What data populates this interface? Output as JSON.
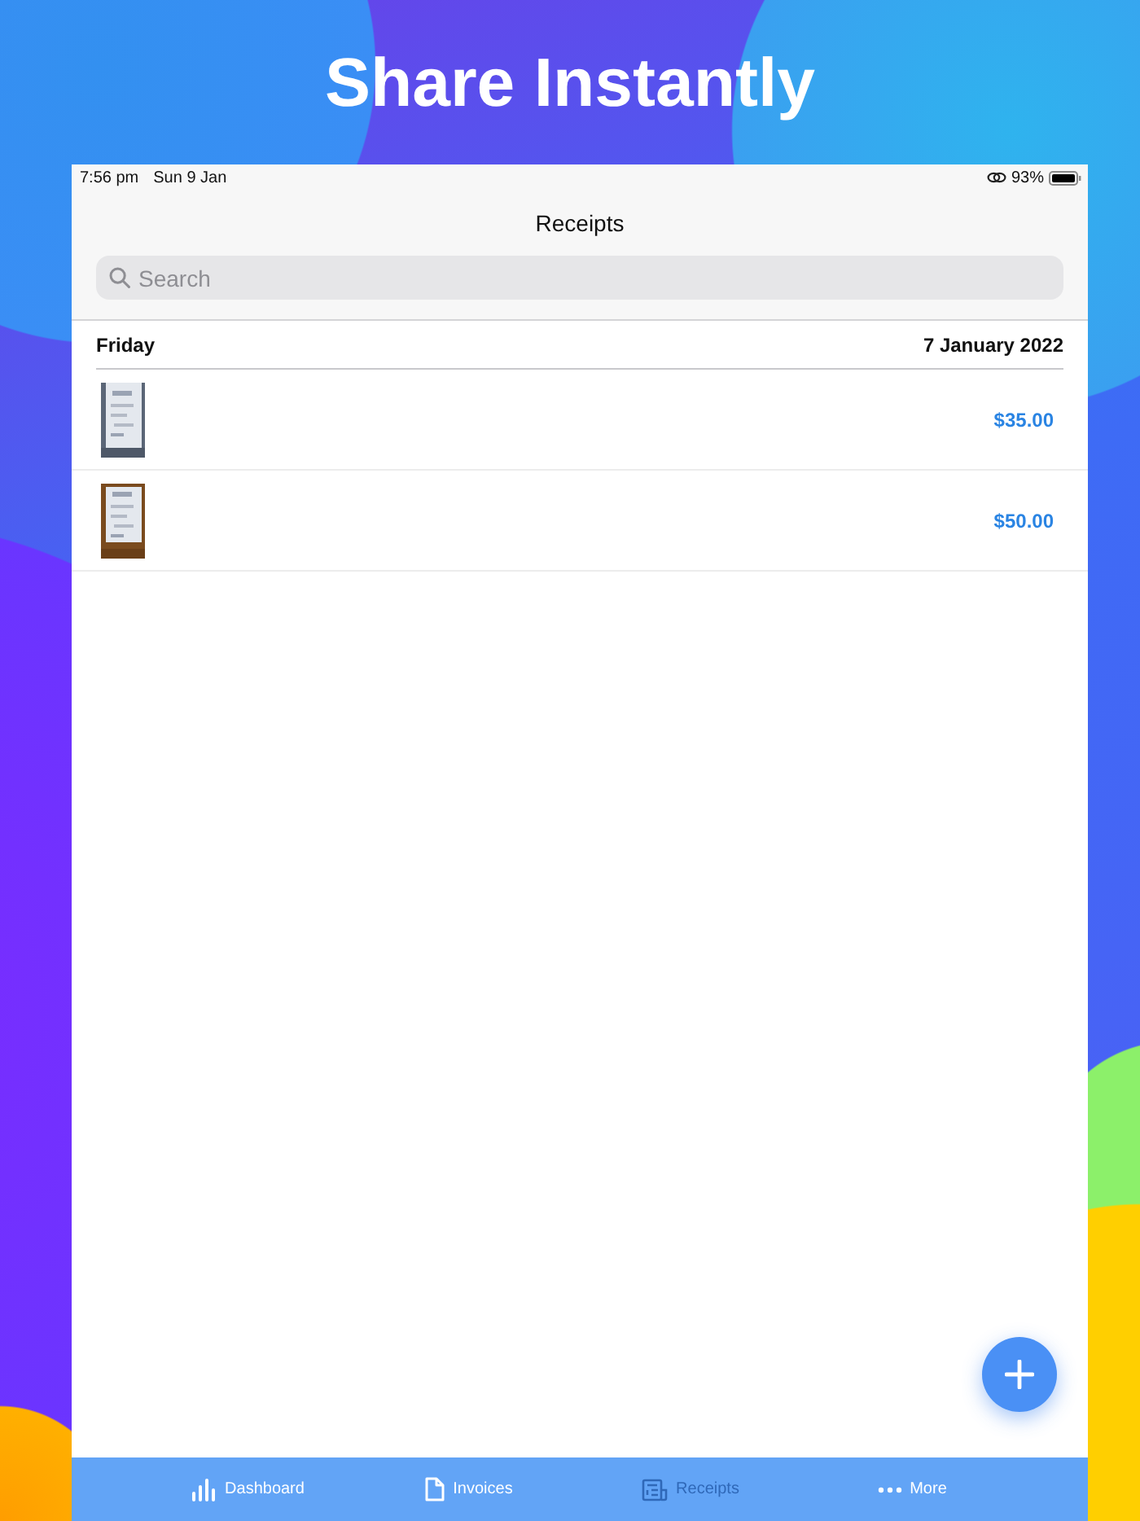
{
  "headline": "Share Instantly",
  "status_bar": {
    "time": "7:56 pm",
    "date": "Sun 9 Jan",
    "battery": "93%"
  },
  "title": "Receipts",
  "search": {
    "placeholder": "Search"
  },
  "section": {
    "day": "Friday",
    "date": "7 January 2022"
  },
  "receipts": [
    {
      "amount": "$35.00"
    },
    {
      "amount": "$50.00"
    }
  ],
  "tabs": [
    {
      "kind": "dashboard",
      "label": "Dashboard",
      "selected": false
    },
    {
      "kind": "invoices",
      "label": "Invoices",
      "selected": false
    },
    {
      "kind": "receipts",
      "label": "Receipts",
      "selected": true
    },
    {
      "kind": "more",
      "label": "More",
      "selected": false
    }
  ]
}
